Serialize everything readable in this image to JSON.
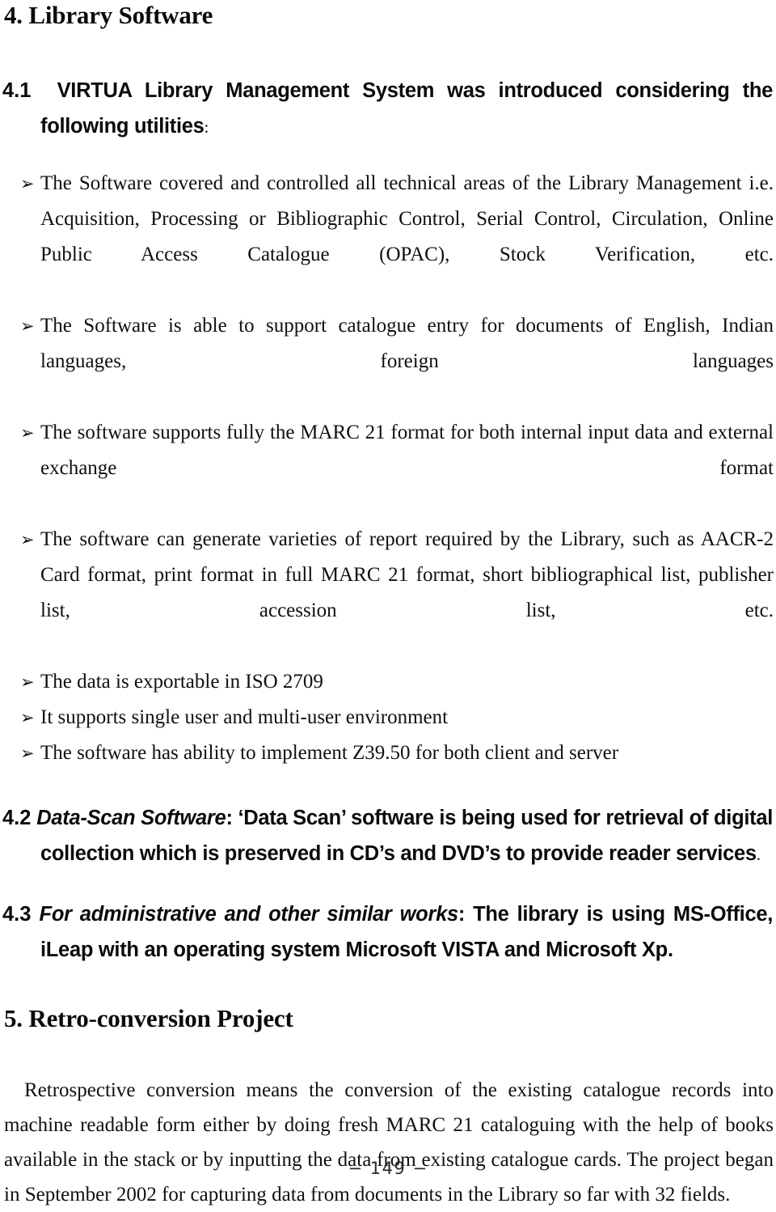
{
  "document": {
    "sections": [
      {
        "id": "sec-4",
        "heading": "4. Library Software"
      }
    ]
  },
  "headings": {
    "section_4": "4. Library Software",
    "section_5": "5. Retro-conversion Project"
  },
  "subsections": {
    "s41": {
      "number": "4.1",
      "text": "VIRTUA Library Management System was introduced considering the following utilities",
      "trailing_punctuation": ":"
    },
    "s42": {
      "number": "4.2",
      "emphasis": "Data-Scan Software",
      "text": ": ‘Data Scan’ software is being used for retrieval of digital collection which is preserved in CD’s and DVD’s to provide reader services",
      "trailing_punctuation": "."
    },
    "s43": {
      "number": "4.3",
      "emphasis": "For administrative and other similar works",
      "text": ": The library is using MS-Office, iLeap with an operating system Microsoft VISTA and Microsoft Xp."
    }
  },
  "bullets": {
    "marker_glyph": "➢",
    "items": [
      {
        "text": "The Software covered and controlled all technical areas of the Library Management i.e. Acquisition, Processing or Bibliographic Control, Serial Control, Circulation, Online Public Access Catalogue (OPAC), Stock Verification, etc.",
        "justified": true
      },
      {
        "text": "The Software is able to support catalogue entry for documents of English, Indian languages, foreign languages",
        "justified": true
      },
      {
        "text": "The software supports fully the MARC 21 format for both internal input data and external exchange format",
        "justified": true
      },
      {
        "text": "The software can generate varieties of report required by the Library, such as AACR-2 Card format, print format in full MARC 21 format, short bibliographical list, publisher list, accession list, etc.",
        "justified": true
      },
      {
        "text": "The data is exportable in ISO 2709",
        "justified": false
      },
      {
        "text": "It supports single user and multi-user environment",
        "justified": false
      },
      {
        "text": "The software has ability to implement Z39.50 for both client and server",
        "justified": false
      }
    ]
  },
  "paragraphs": {
    "retro_conversion": "Retrospective conversion means the conversion of the existing catalogue records into machine readable form either by doing fresh MARC 21 cataloguing with the help of books available in the stack or by inputting the data from existing catalogue cards. The project began in September 2002 for capturing data from documents in the Library so far with 32 fields."
  },
  "footer": {
    "page_number": "− 149 −"
  },
  "colors": {
    "text": "#101010",
    "background": "#ffffff"
  }
}
